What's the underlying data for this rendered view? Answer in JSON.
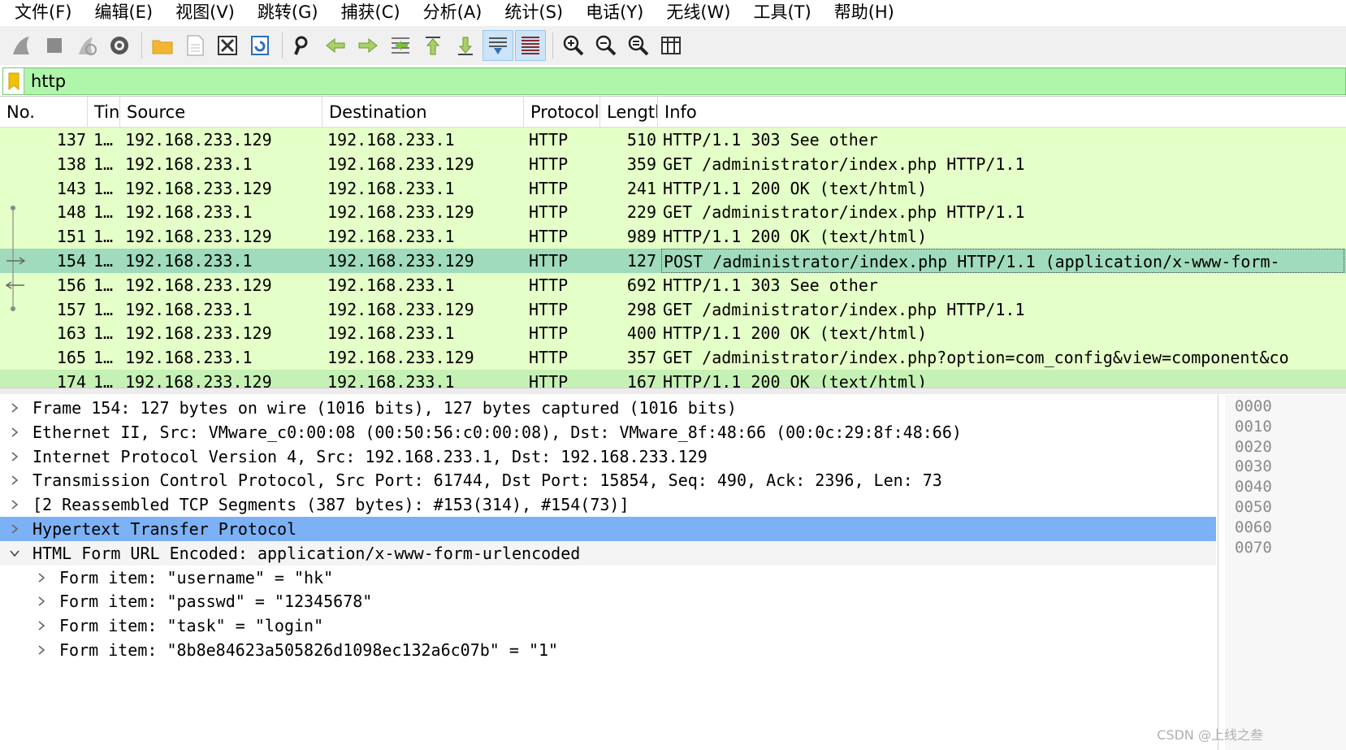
{
  "menu": [
    "文件(F)",
    "编辑(E)",
    "视图(V)",
    "跳转(G)",
    "捕获(C)",
    "分析(A)",
    "统计(S)",
    "电话(Y)",
    "无线(W)",
    "工具(T)",
    "帮助(H)"
  ],
  "toolbar_icons": [
    "shark-fin-start-icon",
    "stop-capture-icon",
    "restart-capture-icon",
    "capture-options-icon",
    "open-file-icon",
    "save-file-icon",
    "close-file-icon",
    "reload-file-icon",
    "find-packet-icon",
    "go-back-icon",
    "go-forward-icon",
    "go-to-packet-icon",
    "first-packet-icon",
    "last-packet-icon",
    "autoscroll-icon",
    "colorize-icon",
    "zoom-in-icon",
    "zoom-out-icon",
    "zoom-normal-icon",
    "resize-columns-icon"
  ],
  "filter": {
    "value": "http"
  },
  "columns": {
    "no": "No.",
    "time": "Tin",
    "source": "Source",
    "destination": "Destination",
    "protocol": "Protocol",
    "length": "Lengtl",
    "info": "Info"
  },
  "packets": [
    {
      "no": "137",
      "time": "1…",
      "source": "192.168.233.129",
      "destination": "192.168.233.1",
      "protocol": "HTTP",
      "length": "510",
      "info": "HTTP/1.1 303 See other"
    },
    {
      "no": "138",
      "time": "1…",
      "source": "192.168.233.1",
      "destination": "192.168.233.129",
      "protocol": "HTTP",
      "length": "359",
      "info": "GET /administrator/index.php HTTP/1.1"
    },
    {
      "no": "143",
      "time": "1…",
      "source": "192.168.233.129",
      "destination": "192.168.233.1",
      "protocol": "HTTP",
      "length": "241",
      "info": "HTTP/1.1 200 OK  (text/html)"
    },
    {
      "no": "148",
      "time": "1…",
      "source": "192.168.233.1",
      "destination": "192.168.233.129",
      "protocol": "HTTP",
      "length": "229",
      "info": "GET /administrator/index.php HTTP/1.1"
    },
    {
      "no": "151",
      "time": "1…",
      "source": "192.168.233.129",
      "destination": "192.168.233.1",
      "protocol": "HTTP",
      "length": "989",
      "info": "HTTP/1.1 200 OK  (text/html)"
    },
    {
      "no": "154",
      "time": "1…",
      "source": "192.168.233.1",
      "destination": "192.168.233.129",
      "protocol": "HTTP",
      "length": "127",
      "info": "POST /administrator/index.php HTTP/1.1  (application/x-www-form-"
    },
    {
      "no": "156",
      "time": "1…",
      "source": "192.168.233.129",
      "destination": "192.168.233.1",
      "protocol": "HTTP",
      "length": "692",
      "info": "HTTP/1.1 303 See other"
    },
    {
      "no": "157",
      "time": "1…",
      "source": "192.168.233.1",
      "destination": "192.168.233.129",
      "protocol": "HTTP",
      "length": "298",
      "info": "GET /administrator/index.php HTTP/1.1"
    },
    {
      "no": "163",
      "time": "1…",
      "source": "192.168.233.129",
      "destination": "192.168.233.1",
      "protocol": "HTTP",
      "length": "400",
      "info": "HTTP/1.1 200 OK  (text/html)"
    },
    {
      "no": "165",
      "time": "1…",
      "source": "192.168.233.1",
      "destination": "192.168.233.129",
      "protocol": "HTTP",
      "length": "357",
      "info": "GET /administrator/index.php?option=com_config&view=component&co"
    },
    {
      "no": "174",
      "time": "1…",
      "source": "192.168.233.129",
      "destination": "192.168.233.1",
      "protocol": "HTTP",
      "length": "167",
      "info": "HTTP/1.1 200 OK  (text/html)"
    }
  ],
  "details": [
    {
      "text": "Frame 154: 127 bytes on wire (1016 bits), 127 bytes captured (1016 bits)",
      "expanded": false
    },
    {
      "text": "Ethernet II, Src: VMware_c0:00:08 (00:50:56:c0:00:08), Dst: VMware_8f:48:66 (00:0c:29:8f:48:66)",
      "expanded": false
    },
    {
      "text": "Internet Protocol Version 4, Src: 192.168.233.1, Dst: 192.168.233.129",
      "expanded": false
    },
    {
      "text": "Transmission Control Protocol, Src Port: 61744, Dst Port: 15854, Seq: 490, Ack: 2396, Len: 73",
      "expanded": false
    },
    {
      "text": "[2 Reassembled TCP Segments (387 bytes): #153(314), #154(73)]",
      "expanded": false
    },
    {
      "text": "Hypertext Transfer Protocol",
      "expanded": false
    },
    {
      "text": "HTML Form URL Encoded: application/x-www-form-urlencoded",
      "expanded": true
    },
    {
      "text": "Form item: \"username\" = \"hk\"",
      "expanded": false
    },
    {
      "text": "Form item: \"passwd\" = \"12345678\"",
      "expanded": false
    },
    {
      "text": "Form item: \"task\" = \"login\"",
      "expanded": false
    },
    {
      "text": "Form item: \"8b8e84623a505826d1098ec132a6c07b\" = \"1\"",
      "expanded": false
    }
  ],
  "hex_offsets": [
    "0000",
    "0010",
    "0020",
    "0030",
    "0040",
    "0050",
    "0060",
    "0070"
  ],
  "watermark": "CSDN @上线之叁",
  "colors": {
    "filter_bg": "#aff5aa",
    "row_bg": "#e4ffc7",
    "row_selected_bg": "#9fdbbc",
    "detail_highlight": "#7db1f5"
  }
}
